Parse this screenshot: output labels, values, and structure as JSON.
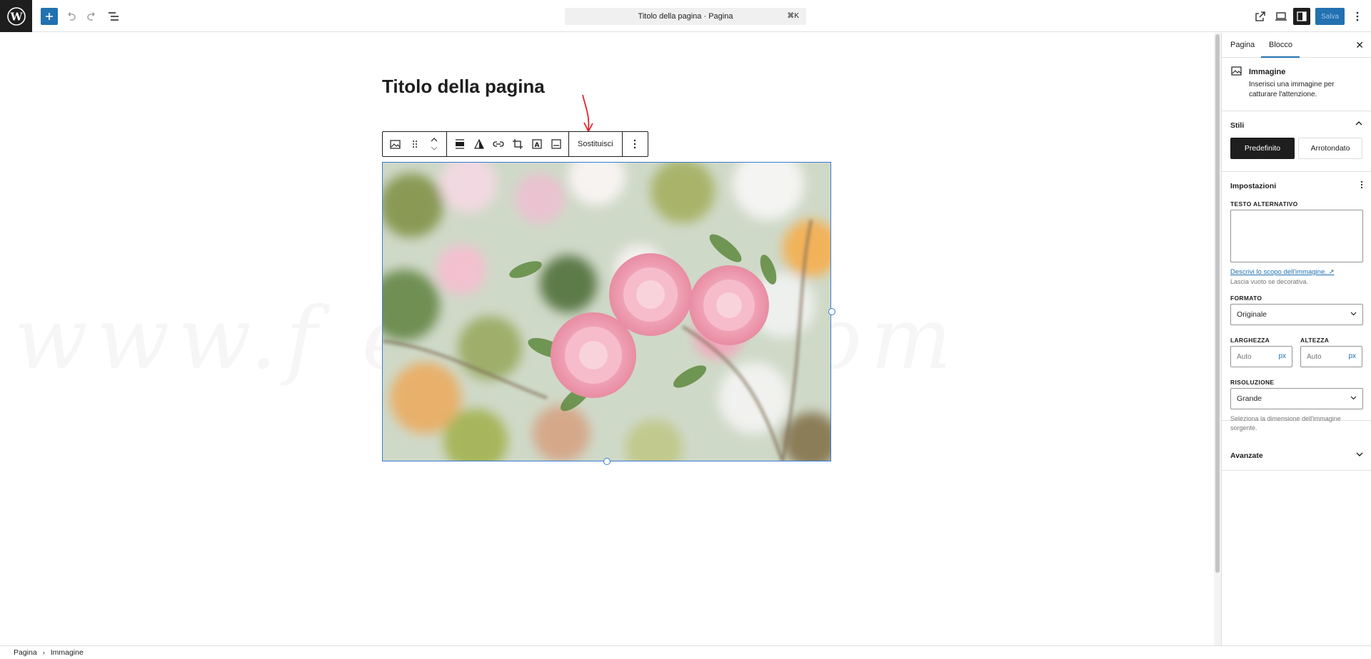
{
  "header": {
    "doc_title": "Titolo della pagina · Pagina",
    "shortcut": "⌘K",
    "save_label": "Salva"
  },
  "editor": {
    "page_title": "Titolo della pagina",
    "replace_label": "Sostituisci",
    "watermark": "www.f      erobon.com"
  },
  "sidebar": {
    "tabs": [
      "Pagina",
      "Blocco"
    ],
    "block_name": "Immagine",
    "block_desc": "Inserisci una immagine per catturare l'attenzione.",
    "styles_title": "Stili",
    "style_default": "Predefinito",
    "style_rounded": "Arrotondato",
    "settings_title": "Impostazioni",
    "alt_label": "TESTO ALTERNATIVO",
    "alt_link": "Descrivi lo scopo dell'immagine. ↗",
    "alt_help": "Lascia vuoto se decorativa.",
    "format_label": "FORMATO",
    "format_value": "Originale",
    "width_label": "LARGHEZZA",
    "height_label": "ALTEZZA",
    "width_placeholder": "Auto",
    "height_placeholder": "Auto",
    "unit": "px",
    "resolution_label": "RISOLUZIONE",
    "resolution_value": "Grande",
    "resolution_help": "Seleziona la dimensione dell'immagine sorgente.",
    "advanced_title": "Avanzate"
  },
  "breadcrumb": [
    "Pagina",
    "Immagine"
  ],
  "colors": {
    "accent": "#2271b1",
    "selection": "#3a7bd5",
    "dark": "#1e1e1e"
  }
}
